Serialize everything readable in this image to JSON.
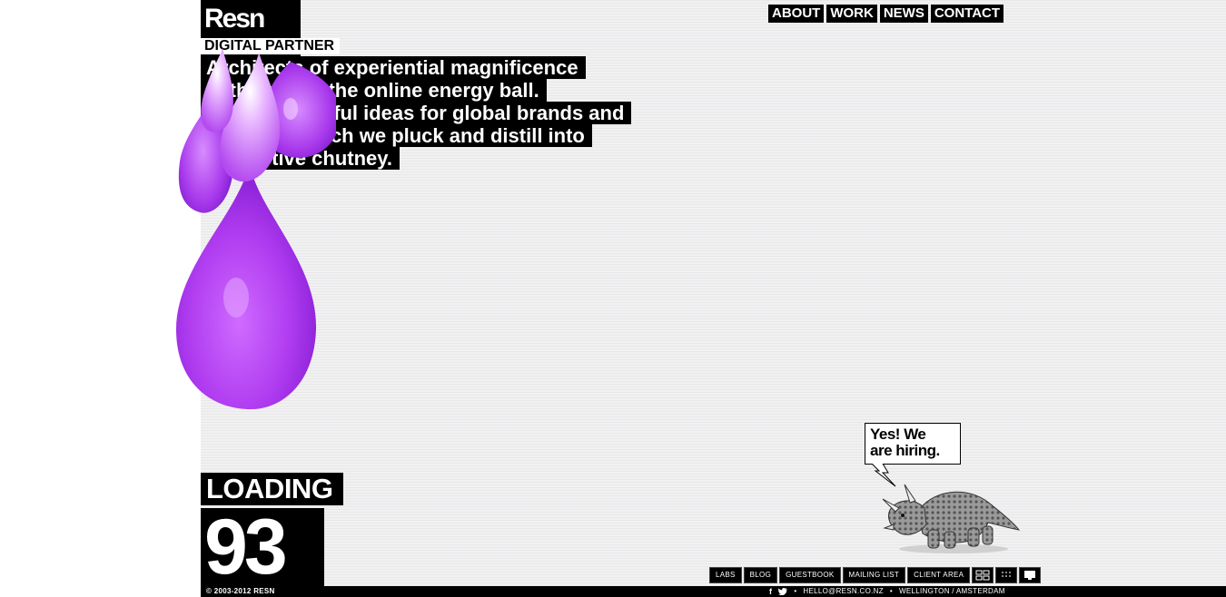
{
  "brand": {
    "logo_text": "Resn",
    "tagline": "DIGITAL PARTNER"
  },
  "intro": {
    "lines": [
      "Architects of experiential magnificence",
      "in the eye of the online energy ball.",
      "We grow fruitful ideas for global brands and",
      "agencies which we pluck and distill into",
      "interactive chutney."
    ]
  },
  "nav": {
    "items": [
      "ABOUT",
      "WORK",
      "NEWS",
      "CONTACT"
    ]
  },
  "loading": {
    "label": "LOADING",
    "percent": "93"
  },
  "hiring": {
    "text_line1": "Yes! We",
    "text_line2": "are hiring."
  },
  "footer_links": {
    "items": [
      "LABS",
      "BLOG",
      "GUESTBOOK",
      "MAILING LIST",
      "CLIENT AREA"
    ],
    "icons": [
      "grid-view-icon",
      "dots-view-icon",
      "monitor-icon"
    ]
  },
  "footer": {
    "copyright": "© 2003-2012 RESN",
    "social_facebook": "f",
    "social_twitter": "t",
    "email": "HELLO@RESN.CO.NZ",
    "locations": "WELLINGTON / AMSTERDAM",
    "separator": "•"
  },
  "colors": {
    "accent_blob": "#b44bf0",
    "background": "#f1f1f2"
  }
}
